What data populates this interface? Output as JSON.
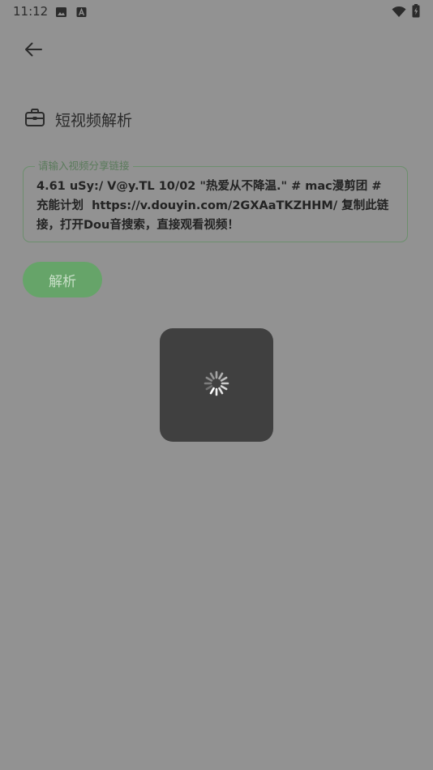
{
  "status_bar": {
    "time": "11:12",
    "icons": [
      "image-icon",
      "font-icon",
      "wifi-icon",
      "battery-charging-icon"
    ]
  },
  "header": {
    "back_icon": "arrow-left-icon"
  },
  "page": {
    "title_icon": "briefcase-icon",
    "title": "短视频解析"
  },
  "link_input": {
    "label": "请输入视频分享链接",
    "value": "4.61 uSy:/ V@y.TL 10/02 \"热爱从不降温.\" # mac漫剪团 # 充能计划  https://v.douyin.com/2GXAaTKZHHM/ 复制此链接，打开Dou音搜索，直接观看视频！"
  },
  "parse_button": {
    "label": "解析"
  },
  "loading": {
    "icon": "spinner-icon"
  },
  "colors": {
    "scrim_background": "#929292",
    "accent_green": "#66a469",
    "dialog_background": "#404040"
  }
}
